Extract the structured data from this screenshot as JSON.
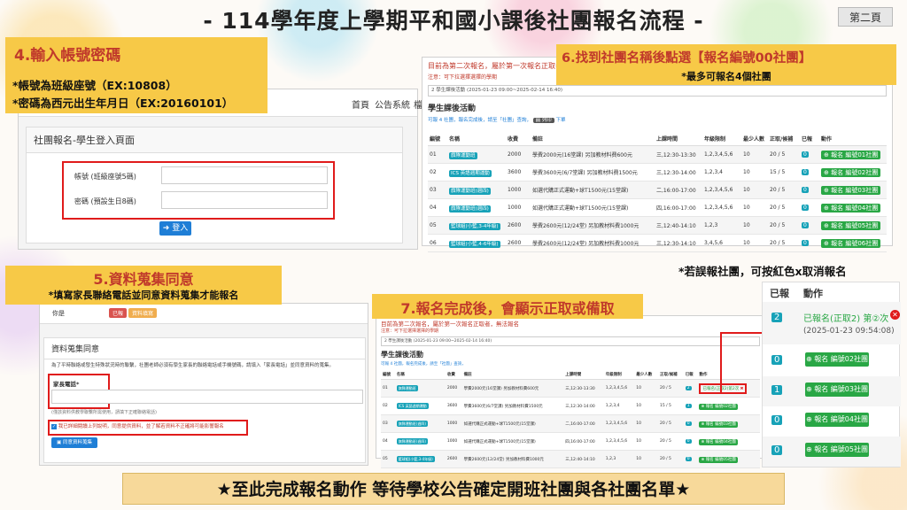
{
  "title": "- 114學年度上學期平和國小課後社團報名流程 -",
  "page_label": "第二頁",
  "step4": {
    "heading": "4.輸入帳號密碼",
    "note1": "*帳號為班級座號（EX:10808）",
    "note2": "*密碼為西元出生年月日（EX:20160101）"
  },
  "login": {
    "nav": [
      "首頁",
      "公告系統",
      "檔"
    ],
    "page_title": "社團報名-學生登入頁面",
    "account_label": "帳號 (班級座號5碼)",
    "password_label": "密碼 (預設生日8碼)",
    "login_button": "登入"
  },
  "step6": {
    "heading": "6.找到社團名稱後點選【報名編號00社團】",
    "note": "*最多可報名4個社團"
  },
  "list_panel": {
    "notice1": "目前為第二次報名，屬於第一次報名正取者...",
    "notice2": "注意：可下拉選擇選擇的學期",
    "select": "2 學生課後活動 (2025-01-23 09:00~2025-02-14 16:40)",
    "section_title": "學生課後活動",
    "sub": "可報 4 社團，報名完成後，請至「社團」查詢，",
    "print": "列印",
    "sub2": "下單",
    "headers": [
      "編號",
      "名稱",
      "收費",
      "備註",
      "上課時間",
      "年級限制",
      "最少人數",
      "正取/候補",
      "已報",
      "動作"
    ],
    "rows": [
      {
        "no": "01",
        "name": "旗隊運動班",
        "fee": "2000",
        "note": "學費2000元(16堂課) 另加教材料費600元",
        "time": "三,12:30-13:30",
        "grades": "1,2,3,4,5,6",
        "min": "10",
        "quota": "20 / 5",
        "reg": "0",
        "action": "報名 編號01社團"
      },
      {
        "no": "02",
        "name": "ICS 英語週期運動",
        "fee": "3600",
        "note": "學費3600元(6/7堂課) 另加教材料費1500元",
        "time": "三,12:30-14:00",
        "grades": "1,2,3,4",
        "min": "10",
        "quota": "15 / 5",
        "reg": "0",
        "action": "報名 編號02社團"
      },
      {
        "no": "03",
        "name": "旗隊運動班(週四)",
        "fee": "1000",
        "note": "如選代購正式運動+球T1500元(15堂課)",
        "time": "二,16:00-17:00",
        "grades": "1,2,3,4,5,6",
        "min": "10",
        "quota": "20 / 5",
        "reg": "0",
        "action": "報名 編號03社團"
      },
      {
        "no": "04",
        "name": "旗隊運動班(週四)",
        "fee": "1000",
        "note": "如選代購正式運動+球T1500元(15堂課)",
        "time": "四,16:00-17:00",
        "grades": "1,2,3,4,5,6",
        "min": "10",
        "quota": "20 / 5",
        "reg": "0",
        "action": "報名 編號04社團"
      },
      {
        "no": "05",
        "name": "籃球組(小籃,3-4年級)",
        "fee": "2600",
        "note": "學費2600元(12/24堂) 另加教材料費1000元",
        "time": "三,12:40-14:10",
        "grades": "1,2,3",
        "min": "10",
        "quota": "20 / 5",
        "reg": "0",
        "action": "報名 編號05社團"
      },
      {
        "no": "06",
        "name": "籃球組(小籃,4-6年級)",
        "fee": "2600",
        "note": "學費2600元(12/24堂) 另加教材料費1000元",
        "time": "三,12:30-14:10",
        "grades": "3,4,5,6",
        "min": "10",
        "quota": "20 / 5",
        "reg": "0",
        "action": "報名 編號06社團"
      }
    ]
  },
  "step5": {
    "heading": "5.資料蒐集同意",
    "note": "*填寫家長聯絡電話並同意資料蒐集才能報名"
  },
  "consent": {
    "row_label": "你是",
    "tag_red": "已報",
    "tag_yellow": "資料填寫",
    "section_title": "資料蒐集同意",
    "desc": "為了平時聯絡或發生特殊狀況時的聯繫，社團老師必須有學生家長的聯絡電話或手機號碼，請填入「家長電話」並同意資料的蒐集。",
    "phone_label": "家長電話*",
    "hint": "(僅該資料供教學聯繫所需使用，請填下正確聯絡電話)",
    "checkbox_text": "我已詳細閱讀上列說明，同意提供資料，並了解若資料不正確將可能影響報名",
    "agree_button": "同意資料蒐集"
  },
  "step7": {
    "heading": "7.報名完成後，會顯示正取或備取"
  },
  "list_panel2": {
    "notice1": "目前為第二次報名，屬於第一次報名正取者，無法報名",
    "notice2": "注意：可下拉選擇選擇的學期",
    "select": "2 學生課後活動 (2025-01-23 09:00~2025-02-14 16:40)",
    "section_title": "學生課後活動",
    "sub": "可報 4 社團，報名完成後，請至「社團」查詢，",
    "rows": [
      {
        "no": "01",
        "name": "旗隊運動班",
        "fee": "2000",
        "note": "學費2000元(16堂課) 另加教材料費600元",
        "time": "三,12:30-13:30",
        "grades": "1,2,3,4,5,6",
        "min": "10",
        "quota": "20 / 5",
        "reg": "2",
        "action": "已報名(正取2)第2次"
      },
      {
        "no": "02",
        "name": "ICS 英語週期運動",
        "fee": "3600",
        "note": "學費3600元(6/7堂課) 另加教材料費1500元",
        "time": "三,12:30-14:00",
        "grades": "1,2,3,4",
        "min": "10",
        "quota": "15 / 5",
        "reg": "1",
        "action": "報名 編號02社團"
      },
      {
        "no": "03",
        "name": "旗隊運動班(週四)",
        "fee": "1000",
        "note": "如選代購正式運動+球T1500元(15堂課)",
        "time": "二,16:00-17:00",
        "grades": "1,2,3,4,5,6",
        "min": "10",
        "quota": "20 / 5",
        "reg": "0",
        "action": "報名 編號03社團"
      },
      {
        "no": "04",
        "name": "旗隊運動班(週四)",
        "fee": "1000",
        "note": "如選代購正式運動+球T1500元(15堂課)",
        "time": "四,16:00-17:00",
        "grades": "1,2,3,4,5,6",
        "min": "10",
        "quota": "20 / 5",
        "reg": "0",
        "action": "報名 編號04社團"
      },
      {
        "no": "05",
        "name": "籃球組(小籃,3-4年級)",
        "fee": "2600",
        "note": "學費2600元(12/24堂) 另加教材料費1000元",
        "time": "三,12:40-14:10",
        "grades": "1,2,3",
        "min": "10",
        "quota": "20 / 5",
        "reg": "0",
        "action": "報名 編號05社團"
      }
    ]
  },
  "cancel_note": "*若誤報社團，可按紅色x取消報名",
  "zoom": {
    "headers": [
      "已報",
      "動作"
    ],
    "rows": [
      {
        "count": "2",
        "status": "已報名(正取2) 第②次",
        "date": "(2025-01-23 09:54:08)"
      },
      {
        "count": "0",
        "button": "報名 編號02社團"
      },
      {
        "count": "1",
        "button": "報名 編號03社團"
      },
      {
        "count": "0",
        "button": "報名 編號04社團"
      },
      {
        "count": "0",
        "button": "報名 編號05社團"
      }
    ]
  },
  "footer": "★至此完成報名動作 等待學校公告確定開班社團與各社團名單★",
  "colors": {
    "callout": "#f7c947",
    "red": "#e01b1b",
    "teal": "#17a2b8",
    "green": "#29a745",
    "blue": "#1e7ed6"
  }
}
